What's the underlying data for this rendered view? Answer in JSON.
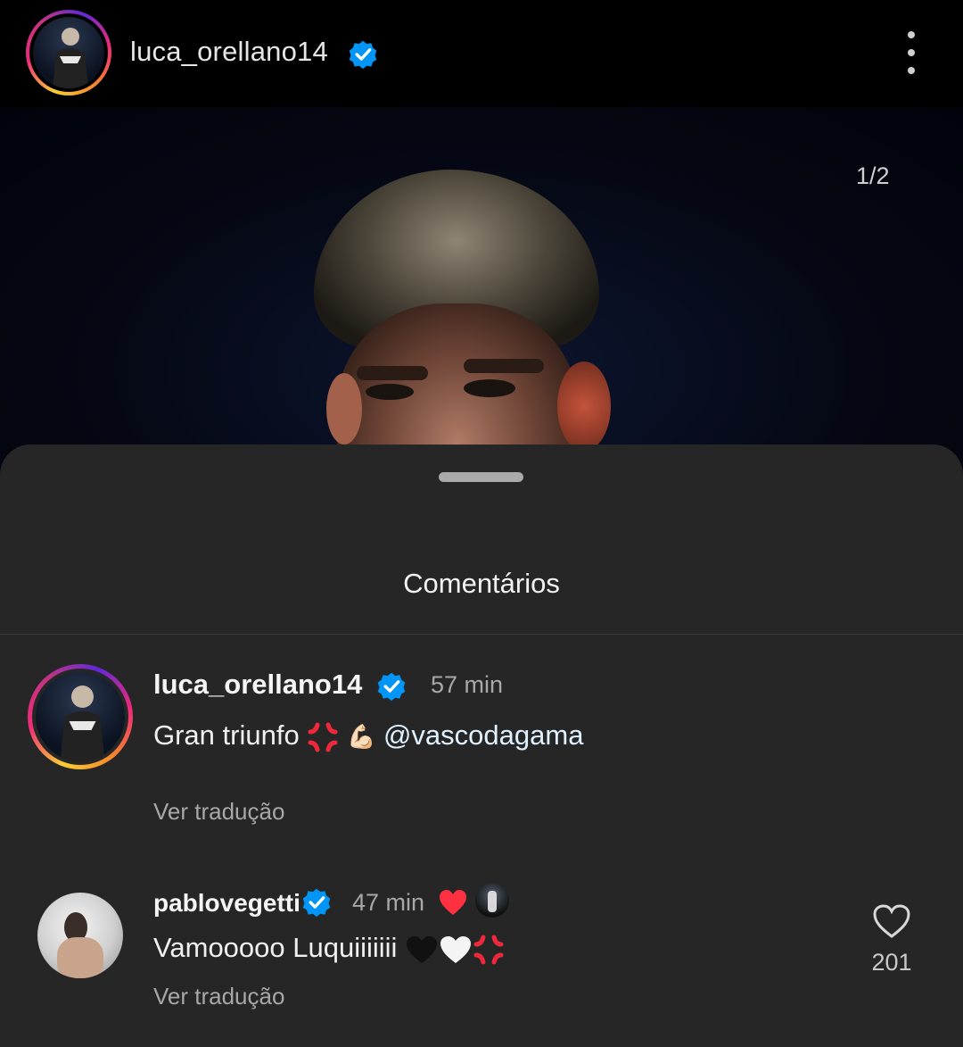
{
  "header": {
    "username": "luca_orellano14",
    "verified_icon": "verified-badge",
    "more_icon": "more-vertical-icon"
  },
  "photo": {
    "counter": "1/2"
  },
  "comments_sheet": {
    "title": "Comentários",
    "comments": [
      {
        "username": "luca_orellano14",
        "time": "57 min",
        "text": "Gran triunfo",
        "emojis": [
          "anger-symbol",
          "flexed-biceps"
        ],
        "mention": "@vascodagama",
        "translate": "Ver tradução"
      },
      {
        "username": "pablovegetti",
        "time": "47 min",
        "text": "Vamooooo Luquiiiiiii",
        "emojis": [
          "black-heart",
          "white-heart",
          "anger-symbol"
        ],
        "translate": "Ver tradução",
        "likes": "201",
        "liked_by_author_icon": "red-heart"
      }
    ]
  },
  "colors": {
    "background": "#000000",
    "sheet": "#262626",
    "verified": "#0095f6",
    "like_red": "#ff3040",
    "secondary_text": "#a8a8a8"
  }
}
